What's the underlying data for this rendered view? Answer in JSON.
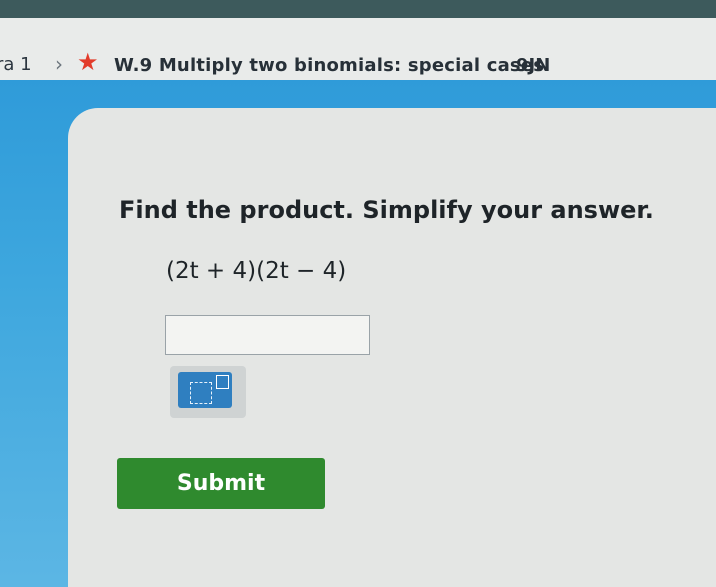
{
  "breadcrumb": {
    "course": "ra 1",
    "chevron": "›",
    "star_icon": "★",
    "skill_title": "W.9 Multiply two binomials: special cases",
    "skill_code": "9JN"
  },
  "question": {
    "prompt": "Find the product. Simplify your answer.",
    "expression": "(2t + 4)(2t − 4)"
  },
  "answer": {
    "value": "",
    "placeholder": ""
  },
  "keypad": {
    "icon": "exponent-keypad-icon"
  },
  "submit": {
    "label": "Submit"
  },
  "colors": {
    "accent_blue": "#3ea7de",
    "submit_green": "#2f8a2e",
    "star_red": "#e23b2a"
  }
}
